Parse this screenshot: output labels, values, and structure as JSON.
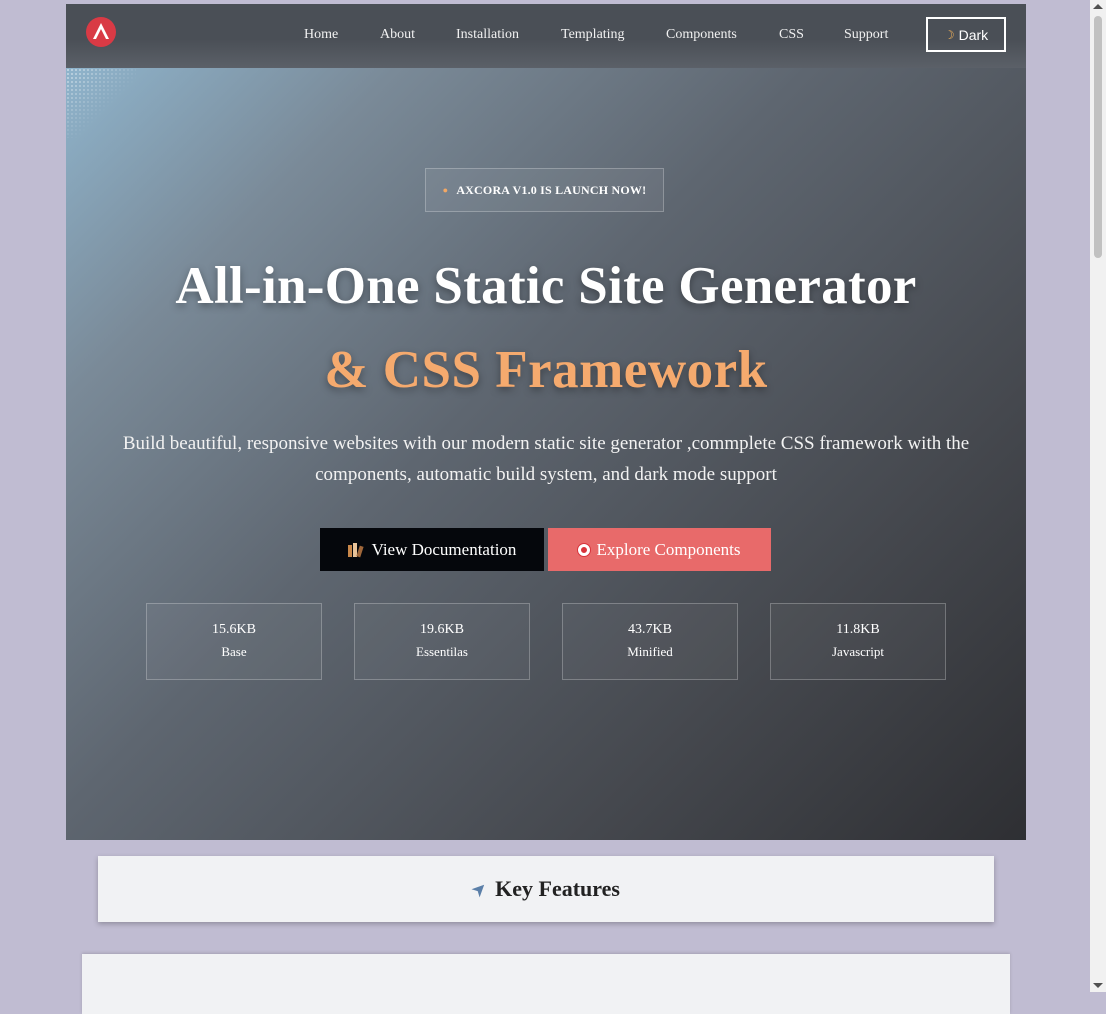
{
  "nav": {
    "logo_icon": "axcora-logo-icon",
    "links": [
      "Home",
      "About",
      "Installation",
      "Templating",
      "Components",
      "CSS",
      "Support"
    ],
    "theme_toggle": {
      "icon": "moon-icon",
      "label": "Dark"
    }
  },
  "hero": {
    "badge": "AXCORA V1.0 IS LAUNCH NOW!",
    "title": "All-in-One Static Site Generator",
    "subtitle": "& CSS Framework",
    "description": "Build beautiful, responsive websites with our modern static site generator ,commplete CSS framework with the components, automatic build system, and dark mode support",
    "buttons": [
      {
        "label": "View Documentation",
        "icon": "books-icon"
      },
      {
        "label": "Explore Components",
        "icon": "target-icon"
      }
    ],
    "stats": [
      {
        "value": "15.6KB",
        "label": "Base"
      },
      {
        "value": "19.6KB",
        "label": "Essentilas"
      },
      {
        "value": "43.7KB",
        "label": "Minified"
      },
      {
        "value": "11.8KB",
        "label": "Javascript"
      }
    ]
  },
  "features": {
    "icon": "rocket-icon",
    "title": "Key Features"
  },
  "colors": {
    "accent": "#f5aa6e",
    "primary_button": "#05070c",
    "secondary_button": "#e86a6a",
    "page_background": "#c0bcd2"
  }
}
